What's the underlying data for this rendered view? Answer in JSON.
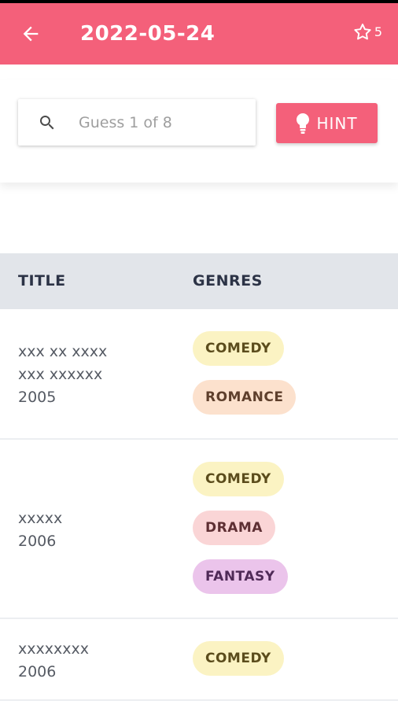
{
  "header": {
    "title": "2022-05-24",
    "star_count": "5",
    "bar_color": "#f4607a"
  },
  "search": {
    "placeholder": "Guess 1 of 8",
    "hint_label": "HINT"
  },
  "table": {
    "columns": [
      "TITLE",
      "GENRES"
    ],
    "rows": [
      {
        "title_lines": [
          "xxx xx xxxx",
          "xxx xxxxxx"
        ],
        "year": "2005",
        "genres": [
          {
            "label": "COMEDY",
            "bg": "#fbf3c3",
            "fg": "#5b4c1c"
          },
          {
            "label": "ROMANCE",
            "bg": "#fce1cd",
            "fg": "#5e3f2c"
          }
        ]
      },
      {
        "title_lines": [
          "xxxxx"
        ],
        "year": "2006",
        "genres": [
          {
            "label": "COMEDY",
            "bg": "#fbf3c3",
            "fg": "#5b4c1c"
          },
          {
            "label": "DRAMA",
            "bg": "#fad5d6",
            "fg": "#5e2f33"
          },
          {
            "label": "FANTASY",
            "bg": "#ebc4eb",
            "fg": "#4f2a57"
          }
        ]
      },
      {
        "title_lines": [
          "xxxxxxxx"
        ],
        "year": "2006",
        "genres": [
          {
            "label": "COMEDY",
            "bg": "#fbf3c3",
            "fg": "#5b4c1c"
          }
        ]
      }
    ]
  }
}
